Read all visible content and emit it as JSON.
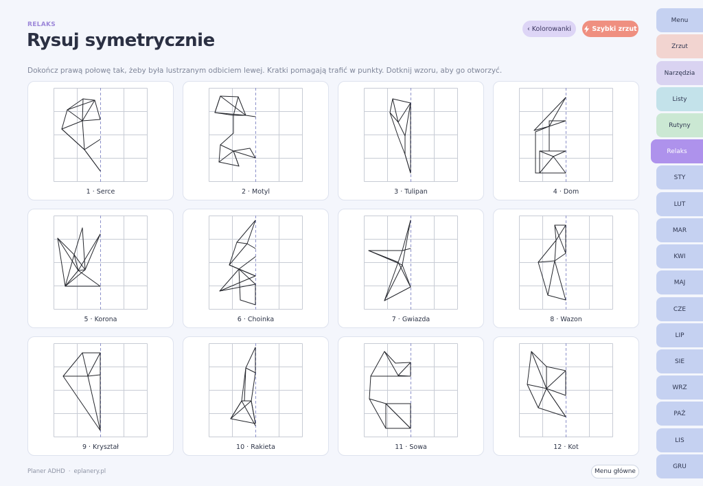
{
  "header": {
    "kicker": "RELAKS",
    "title": "Rysuj symetrycznie",
    "subtitle": "Dokończ prawą połowę tak, żeby była lustrzanym odbiciem lewej. Kratki pomagają trafić w punkty. Dotknij wzoru, aby go otworzyć.",
    "coloring_label": "‹ Kolorowanki",
    "quick_label": "Szybki zrzut"
  },
  "cards": [
    {
      "label": "1 · Serce",
      "lines": [
        [
          43,
          16,
          20,
          32
        ],
        [
          20,
          32,
          12,
          60
        ],
        [
          12,
          60,
          45,
          90
        ],
        [
          45,
          90,
          68,
          121
        ],
        [
          43,
          16,
          60,
          18
        ],
        [
          60,
          18,
          68,
          46
        ],
        [
          43,
          16,
          42,
          48
        ],
        [
          20,
          32,
          42,
          48
        ],
        [
          12,
          60,
          42,
          48
        ],
        [
          42,
          48,
          60,
          18
        ],
        [
          42,
          48,
          68,
          46
        ],
        [
          42,
          48,
          45,
          90
        ],
        [
          45,
          90,
          68,
          75
        ],
        [
          45,
          90,
          68,
          121
        ],
        [
          20,
          32,
          60,
          18
        ],
        [
          12,
          60,
          45,
          90
        ]
      ]
    },
    {
      "label": "2 · Motyl",
      "lines": [
        [
          17,
          12,
          9,
          36
        ],
        [
          9,
          36,
          36,
          40
        ],
        [
          36,
          40,
          36,
          66
        ],
        [
          36,
          66,
          17,
          83
        ],
        [
          17,
          83,
          15,
          108
        ],
        [
          15,
          108,
          36,
          92
        ],
        [
          36,
          92,
          44,
          114
        ],
        [
          17,
          12,
          43,
          13
        ],
        [
          43,
          13,
          54,
          40
        ],
        [
          54,
          40,
          68,
          42
        ],
        [
          9,
          36,
          17,
          12
        ],
        [
          43,
          13,
          36,
          40
        ],
        [
          54,
          40,
          36,
          40
        ],
        [
          9,
          36,
          54,
          40
        ],
        [
          36,
          92,
          68,
          102
        ],
        [
          17,
          83,
          36,
          92
        ],
        [
          36,
          92,
          60,
          88
        ],
        [
          60,
          88,
          68,
          102
        ],
        [
          44,
          114,
          36,
          92
        ],
        [
          15,
          108,
          44,
          114
        ],
        [
          17,
          12,
          54,
          40
        ]
      ]
    },
    {
      "label": "3 · Tulipan",
      "lines": [
        [
          42,
          16,
          38,
          36
        ],
        [
          38,
          36,
          50,
          71
        ],
        [
          50,
          71,
          60,
          97
        ],
        [
          60,
          97,
          68,
          124
        ],
        [
          68,
          124,
          68,
          22
        ],
        [
          42,
          16,
          68,
          22
        ],
        [
          42,
          16,
          50,
          50
        ],
        [
          50,
          50,
          68,
          22
        ],
        [
          38,
          36,
          50,
          50
        ],
        [
          50,
          50,
          60,
          70
        ],
        [
          60,
          70,
          68,
          22
        ],
        [
          60,
          70,
          60,
          97
        ],
        [
          60,
          97,
          68,
          124
        ]
      ]
    },
    {
      "label": "4 · Dom",
      "lines": [
        [
          68,
          14,
          22,
          62
        ],
        [
          22,
          62,
          44,
          56
        ],
        [
          44,
          56,
          68,
          14
        ],
        [
          44,
          56,
          24,
          64
        ],
        [
          24,
          64,
          24,
          124
        ],
        [
          24,
          124,
          68,
          124
        ],
        [
          30,
          92,
          30,
          124
        ],
        [
          30,
          92,
          68,
          92
        ],
        [
          44,
          48,
          44,
          92
        ],
        [
          44,
          48,
          68,
          48
        ],
        [
          30,
          92,
          50,
          100
        ],
        [
          50,
          100,
          68,
          92
        ],
        [
          30,
          124,
          50,
          100
        ],
        [
          50,
          100,
          68,
          124
        ],
        [
          44,
          56,
          68,
          48
        ]
      ]
    },
    {
      "label": "5 · Korona",
      "lines": [
        [
          6,
          33,
          17,
          103
        ],
        [
          17,
          103,
          68,
          103
        ],
        [
          6,
          33,
          36,
          80
        ],
        [
          36,
          80,
          68,
          103
        ],
        [
          36,
          80,
          17,
          103
        ],
        [
          36,
          80,
          68,
          27
        ],
        [
          36,
          80,
          46,
          79
        ],
        [
          46,
          79,
          68,
          27
        ],
        [
          30,
          57,
          46,
          79
        ],
        [
          30,
          57,
          36,
          80
        ],
        [
          30,
          57,
          42,
          18
        ],
        [
          42,
          18,
          46,
          79
        ],
        [
          30,
          57,
          17,
          103
        ],
        [
          6,
          33,
          30,
          57
        ],
        [
          17,
          103,
          46,
          79
        ]
      ]
    },
    {
      "label": "6 · Choinka",
      "lines": [
        [
          68,
          7,
          41,
          39
        ],
        [
          41,
          39,
          56,
          41
        ],
        [
          56,
          41,
          30,
          72
        ],
        [
          30,
          72,
          44,
          78
        ],
        [
          44,
          78,
          16,
          110
        ],
        [
          16,
          110,
          68,
          100
        ],
        [
          68,
          7,
          56,
          41
        ],
        [
          56,
          41,
          68,
          48
        ],
        [
          41,
          39,
          30,
          72
        ],
        [
          44,
          78,
          68,
          60
        ],
        [
          44,
          78,
          68,
          100
        ],
        [
          30,
          72,
          68,
          88
        ],
        [
          16,
          110,
          68,
          88
        ],
        [
          44,
          78,
          68,
          88
        ],
        [
          44,
          78,
          46,
          123
        ],
        [
          46,
          123,
          68,
          130
        ],
        [
          68,
          130,
          68,
          100
        ]
      ]
    },
    {
      "label": "7 · Gwiazda",
      "lines": [
        [
          68,
          7,
          56,
          51
        ],
        [
          56,
          51,
          7,
          51
        ],
        [
          7,
          51,
          50,
          68
        ],
        [
          50,
          68,
          30,
          124
        ],
        [
          30,
          124,
          68,
          104
        ],
        [
          68,
          104,
          56,
          72
        ],
        [
          56,
          72,
          68,
          7
        ],
        [
          7,
          51,
          56,
          72
        ],
        [
          56,
          51,
          50,
          68
        ],
        [
          50,
          68,
          68,
          104
        ],
        [
          56,
          72,
          30,
          124
        ],
        [
          56,
          51,
          68,
          48
        ]
      ]
    },
    {
      "label": "8 · Wazon",
      "lines": [
        [
          52,
          14,
          68,
          14
        ],
        [
          68,
          14,
          68,
          55
        ],
        [
          52,
          14,
          54,
          36
        ],
        [
          54,
          36,
          28,
          68
        ],
        [
          28,
          68,
          42,
          116
        ],
        [
          42,
          116,
          68,
          123
        ],
        [
          68,
          123,
          52,
          66
        ],
        [
          52,
          66,
          68,
          55
        ],
        [
          54,
          36,
          52,
          66
        ],
        [
          52,
          66,
          28,
          68
        ],
        [
          52,
          66,
          42,
          116
        ],
        [
          54,
          36,
          68,
          14
        ],
        [
          52,
          14,
          68,
          55
        ]
      ]
    },
    {
      "label": "9 · Kryształ",
      "lines": [
        [
          42,
          14,
          68,
          14
        ],
        [
          68,
          14,
          68,
          127
        ],
        [
          42,
          14,
          14,
          48
        ],
        [
          14,
          48,
          68,
          127
        ],
        [
          14,
          48,
          50,
          48
        ],
        [
          50,
          48,
          68,
          14
        ],
        [
          42,
          14,
          50,
          48
        ],
        [
          50,
          48,
          68,
          127
        ],
        [
          42,
          14,
          68,
          14
        ],
        [
          50,
          48,
          68,
          46
        ]
      ]
    },
    {
      "label": "10 · Rakieta",
      "lines": [
        [
          68,
          6,
          54,
          36
        ],
        [
          54,
          36,
          68,
          43
        ],
        [
          68,
          43,
          68,
          6
        ],
        [
          54,
          36,
          48,
          84
        ],
        [
          48,
          84,
          32,
          110
        ],
        [
          32,
          110,
          68,
          117
        ],
        [
          68,
          117,
          62,
          84
        ],
        [
          62,
          84,
          48,
          84
        ],
        [
          48,
          84,
          68,
          120
        ],
        [
          62,
          84,
          32,
          110
        ],
        [
          48,
          84,
          32,
          110
        ],
        [
          62,
          84,
          68,
          117
        ],
        [
          54,
          36,
          52,
          84
        ],
        [
          68,
          43,
          62,
          84
        ]
      ]
    },
    {
      "label": "11 · Sowa",
      "lines": [
        [
          30,
          12,
          46,
          29
        ],
        [
          46,
          29,
          68,
          28
        ],
        [
          68,
          28,
          68,
          48
        ],
        [
          68,
          28,
          50,
          47
        ],
        [
          30,
          12,
          10,
          48
        ],
        [
          10,
          48,
          8,
          81
        ],
        [
          8,
          81,
          32,
          124
        ],
        [
          32,
          124,
          68,
          124
        ],
        [
          68,
          124,
          68,
          88
        ],
        [
          68,
          88,
          32,
          88
        ],
        [
          32,
          88,
          8,
          81
        ],
        [
          32,
          88,
          68,
          124
        ],
        [
          32,
          88,
          32,
          124
        ],
        [
          30,
          12,
          50,
          47
        ],
        [
          50,
          47,
          68,
          48
        ],
        [
          10,
          48,
          68,
          48
        ],
        [
          32,
          88,
          68,
          124
        ]
      ]
    },
    {
      "label": "12 · Kot",
      "lines": [
        [
          18,
          12,
          12,
          60
        ],
        [
          12,
          60,
          28,
          94
        ],
        [
          28,
          94,
          68,
          107
        ],
        [
          68,
          107,
          40,
          66
        ],
        [
          40,
          66,
          68,
          76
        ],
        [
          68,
          76,
          68,
          40
        ],
        [
          68,
          40,
          40,
          34
        ],
        [
          40,
          34,
          18,
          12
        ],
        [
          18,
          12,
          40,
          66
        ],
        [
          12,
          60,
          40,
          66
        ],
        [
          40,
          66,
          28,
          94
        ],
        [
          40,
          34,
          40,
          66
        ],
        [
          40,
          66,
          68,
          40
        ],
        [
          40,
          66,
          68,
          107
        ]
      ]
    }
  ],
  "sidebar": {
    "tabs": [
      {
        "label": "Menu",
        "color": "#c5d1f1"
      },
      {
        "label": "Zrzut",
        "color": "#f2d4d0"
      },
      {
        "label": "Narzędzia",
        "color": "#d9d3f1"
      },
      {
        "label": "Listy",
        "color": "#c3e2ea"
      },
      {
        "label": "Rutyny",
        "color": "#cbe8d3"
      },
      {
        "label": "Relaks",
        "color": "#ae92ec"
      },
      {
        "label": "STY",
        "color": "#c5d1f1"
      },
      {
        "label": "LUT",
        "color": "#c5d1f1"
      },
      {
        "label": "MAR",
        "color": "#c5d1f1"
      },
      {
        "label": "KWI",
        "color": "#c5d1f1"
      },
      {
        "label": "MAJ",
        "color": "#c5d1f1"
      },
      {
        "label": "CZE",
        "color": "#c5d1f1"
      },
      {
        "label": "LIP",
        "color": "#c5d1f1"
      },
      {
        "label": "SIE",
        "color": "#c5d1f1"
      },
      {
        "label": "WRZ",
        "color": "#c5d1f1"
      },
      {
        "label": "PAŹ",
        "color": "#c5d1f1"
      },
      {
        "label": "LIS",
        "color": "#c5d1f1"
      },
      {
        "label": "GRU",
        "color": "#c5d1f1"
      }
    ]
  },
  "footer": {
    "brand": "Planer ADHD",
    "site": "eplanery.pl",
    "main_menu_label": "Menu główne"
  }
}
